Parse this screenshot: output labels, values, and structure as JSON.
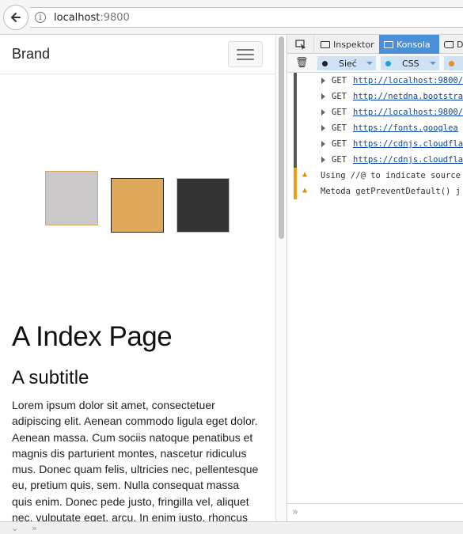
{
  "browser": {
    "url_host": "localhost",
    "url_port": ":9800"
  },
  "page": {
    "brand": "Brand",
    "title": "A Index Page",
    "subtitle": "A subtitle",
    "paragraph": "Lorem ipsum dolor sit amet, consectetuer adipiscing elit. Aenean commodo ligula eget dolor. Aenean massa. Cum sociis natoque penatibus et magnis dis parturient montes, nascetur ridiculus mus. Donec quam felis, ultricies nec, pellentesque eu, pretium quis, sem. Nulla consequat massa quis enim. Donec pede justo, fringilla vel, aliquet nec, vulputate eget, arcu. In enim justo, rhoncus ut,",
    "swatches": [
      "#cac8c9",
      "#dea95b",
      "#333333"
    ]
  },
  "devtools": {
    "tabs": {
      "inspector": "Inspektor",
      "console": "Konsola",
      "debugger": "D"
    },
    "filters": {
      "network": "Sieć",
      "css": "CSS"
    },
    "log": [
      {
        "method": "GET",
        "url": "http://localhost:9800/"
      },
      {
        "method": "GET",
        "url": "http://netdna.bootstra"
      },
      {
        "method": "GET",
        "url": "http://localhost:9800/"
      },
      {
        "method": "GET",
        "url": "https://fonts.googlea"
      },
      {
        "method": "GET",
        "url": "https://cdnjs.cloudfla"
      },
      {
        "method": "GET",
        "url": "https://cdnjs.cloudfla"
      }
    ],
    "warnings": [
      "Using //@ to indicate source",
      "Metoda getPreventDefault() j"
    ],
    "prompt": "»"
  }
}
